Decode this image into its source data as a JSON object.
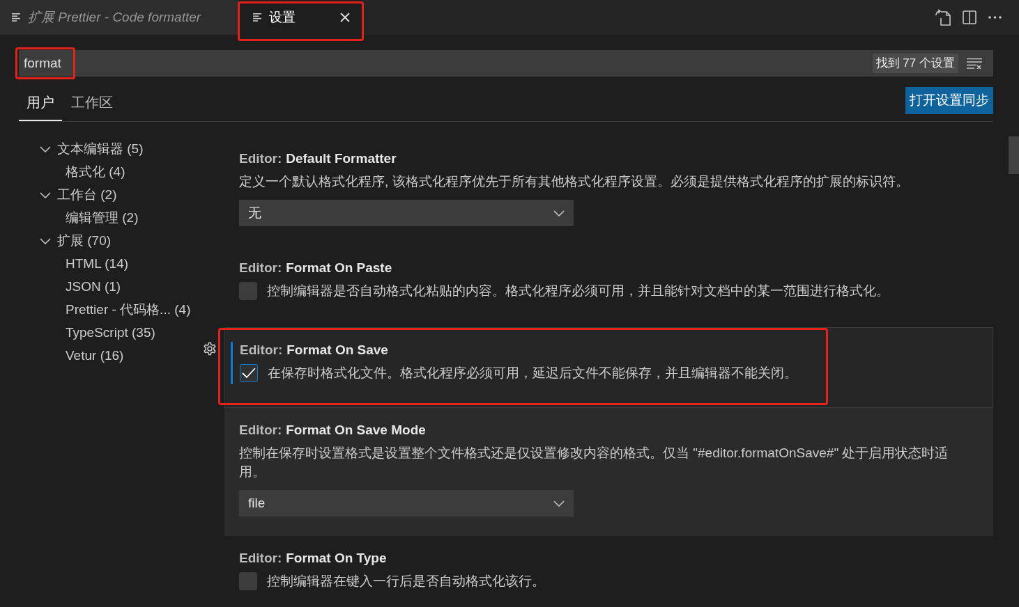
{
  "editor_tabs": [
    {
      "label": "扩展 Prettier - Code formatter",
      "selected": false,
      "preview": true,
      "highlighted": false
    },
    {
      "label": "设置",
      "selected": true,
      "preview": false,
      "highlighted": true
    }
  ],
  "search": {
    "value": "format",
    "highlighted": true,
    "result_count": "找到 77 个设置"
  },
  "scope_tabs": [
    {
      "label": "用户",
      "selected": true
    },
    {
      "label": "工作区",
      "selected": false
    }
  ],
  "sync_button": "打开设置同步",
  "toc": [
    {
      "label": "文本编辑器 (5)",
      "expanded": true,
      "children": [
        {
          "label": "格式化 (4)"
        }
      ]
    },
    {
      "label": "工作台 (2)",
      "expanded": true,
      "children": [
        {
          "label": "编辑管理 (2)"
        }
      ]
    },
    {
      "label": "扩展 (70)",
      "expanded": true,
      "children": [
        {
          "label": "HTML (14)"
        },
        {
          "label": "JSON (1)"
        },
        {
          "label": "Prettier - 代码格... (4)"
        },
        {
          "label": "TypeScript (35)"
        },
        {
          "label": "Vetur (16)"
        }
      ]
    }
  ],
  "settings": [
    {
      "kind": "dropdown",
      "category": "Editor:",
      "name": "Default Formatter",
      "description": "定义一个默认格式化程序, 该格式化程序优先于所有其他格式化程序设置。必须是提供格式化程序的扩展的标识符。",
      "value": "无",
      "focused": false,
      "hovered": false,
      "highlighted": false
    },
    {
      "kind": "checkbox",
      "category": "Editor:",
      "name": "Format On Paste",
      "description": "控制编辑器是否自动格式化粘贴的内容。格式化程序必须可用，并且能针对文档中的某一范围进行格式化。",
      "checked": false,
      "focused": false,
      "hovered": false,
      "highlighted": false
    },
    {
      "kind": "checkbox",
      "category": "Editor:",
      "name": "Format On Save",
      "description": "在保存时格式化文件。格式化程序必须可用，延迟后文件不能保存，并且编辑器不能关闭。",
      "checked": true,
      "focused": true,
      "hovered": false,
      "highlighted": true
    },
    {
      "kind": "dropdown",
      "category": "Editor:",
      "name": "Format On Save Mode",
      "description": "控制在保存时设置格式是设置整个文件格式还是仅设置修改内容的格式。仅当 \"#editor.formatOnSave#\" 处于启用状态时适用。",
      "value": "file",
      "focused": false,
      "hovered": true,
      "highlighted": false
    },
    {
      "kind": "checkbox",
      "category": "Editor:",
      "name": "Format On Type",
      "description": "控制编辑器在键入一行后是否自动格式化该行。",
      "checked": false,
      "focused": false,
      "hovered": false,
      "highlighted": false
    }
  ]
}
